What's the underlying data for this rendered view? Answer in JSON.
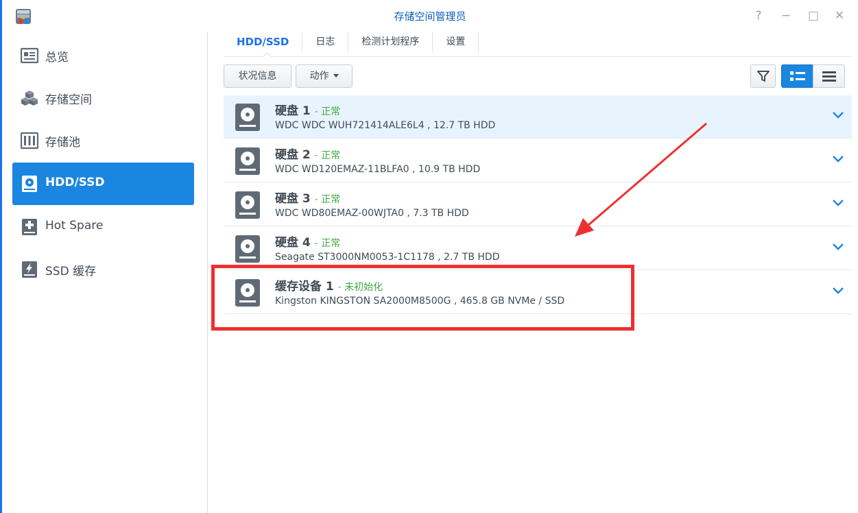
{
  "window": {
    "title": "存储空间管理员",
    "controls": [
      "?",
      "−",
      "□",
      "✕"
    ]
  },
  "sidebar": {
    "items": [
      {
        "label": "总览",
        "icon": "overview-icon"
      },
      {
        "label": "存储空间",
        "icon": "storage-volume-icon"
      },
      {
        "label": "存储池",
        "icon": "storage-pool-icon"
      },
      {
        "label": "HDD/SSD",
        "icon": "hdd-ssd-icon",
        "active": true
      },
      {
        "label": "Hot Spare",
        "icon": "hot-spare-icon"
      },
      {
        "label": "SSD 缓存",
        "icon": "ssd-cache-icon"
      }
    ]
  },
  "tabs": [
    {
      "label": "HDD/SSD",
      "active": true
    },
    {
      "label": "日志"
    },
    {
      "label": "检测计划程序"
    },
    {
      "label": "设置"
    }
  ],
  "toolbar": {
    "status_label": "状况信息",
    "action_label": "动作",
    "filter_icon": "filter-icon",
    "view_modes": [
      "detail-list-icon",
      "compact-list-icon"
    ]
  },
  "disks": [
    {
      "name": "硬盘 1",
      "status": "正常",
      "desc": "WDC WDC WUH721414ALE6L4 , 12.7 TB HDD",
      "selected": true
    },
    {
      "name": "硬盘 2",
      "status": "正常",
      "desc": "WDC WD120EMAZ-11BLFA0 , 10.9 TB HDD"
    },
    {
      "name": "硬盘 3",
      "status": "正常",
      "desc": "WDC WD80EMAZ-00WJTA0 , 7.3 TB HDD"
    },
    {
      "name": "硬盘 4",
      "status": "正常",
      "desc": "Seagate ST3000NM0053-1C1178 , 2.7 TB HDD"
    },
    {
      "name": "缓存设备 1",
      "status": "未初始化",
      "desc": "Kingston KINGSTON SA2000M8500G , 465.8 GB NVMe / SSD"
    }
  ],
  "colors": {
    "accent": "#1a86e0",
    "status_ok": "#3fa83f",
    "annotation_red": "#ee2f2f"
  }
}
